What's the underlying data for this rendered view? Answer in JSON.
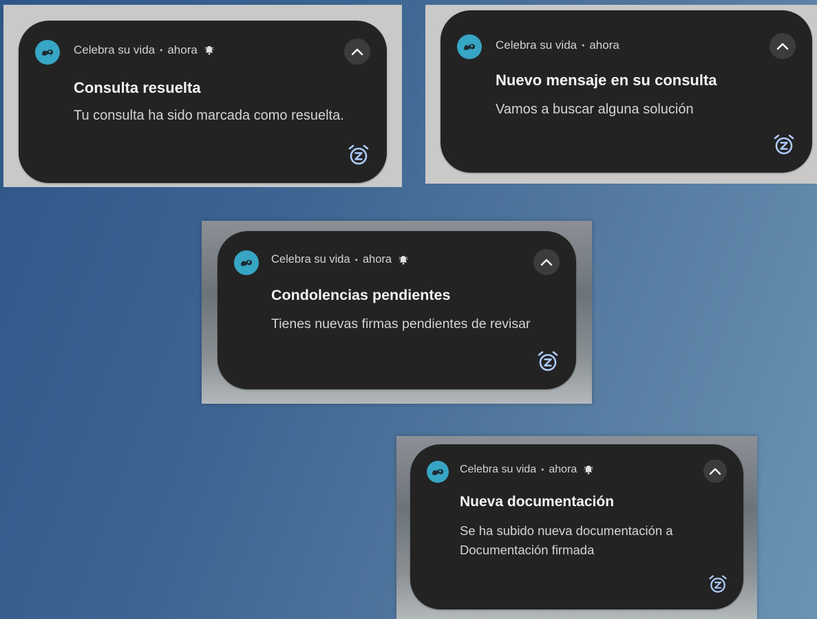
{
  "colors": {
    "card_background": "#232323",
    "app_icon_background": "#37a5c4",
    "snooze_icon": "#aecbff",
    "title_text": "#f3f3f3",
    "body_text": "#d4d4d4"
  },
  "notifications": [
    {
      "app_name": "Celebra su vida",
      "separator": "•",
      "time": "ahora",
      "alert_icon": "bell-icon",
      "title": "Consulta resuelta",
      "body": "Tu consulta ha sido marcada como resuelta."
    },
    {
      "app_name": "Celebra su vida",
      "separator": "•",
      "time": "ahora",
      "title": "Nuevo mensaje en su consulta",
      "body": "Vamos a buscar alguna solución"
    },
    {
      "app_name": "Celebra su vida",
      "separator": "•",
      "time": "ahora",
      "alert_icon": "bell-icon",
      "title": "Condolencias pendientes",
      "body": "Tienes nuevas firmas pendientes de revisar"
    },
    {
      "app_name": "Celebra su vida",
      "separator": "•",
      "time": "ahora",
      "alert_icon": "bell-icon",
      "title": "Nueva documentación",
      "body": "Se ha subido nueva documentación a Documentación firmada"
    }
  ],
  "icons": {
    "app": "app-logo-icon",
    "expand": "chevron-up-icon",
    "snooze": "snooze-alarm-icon"
  }
}
